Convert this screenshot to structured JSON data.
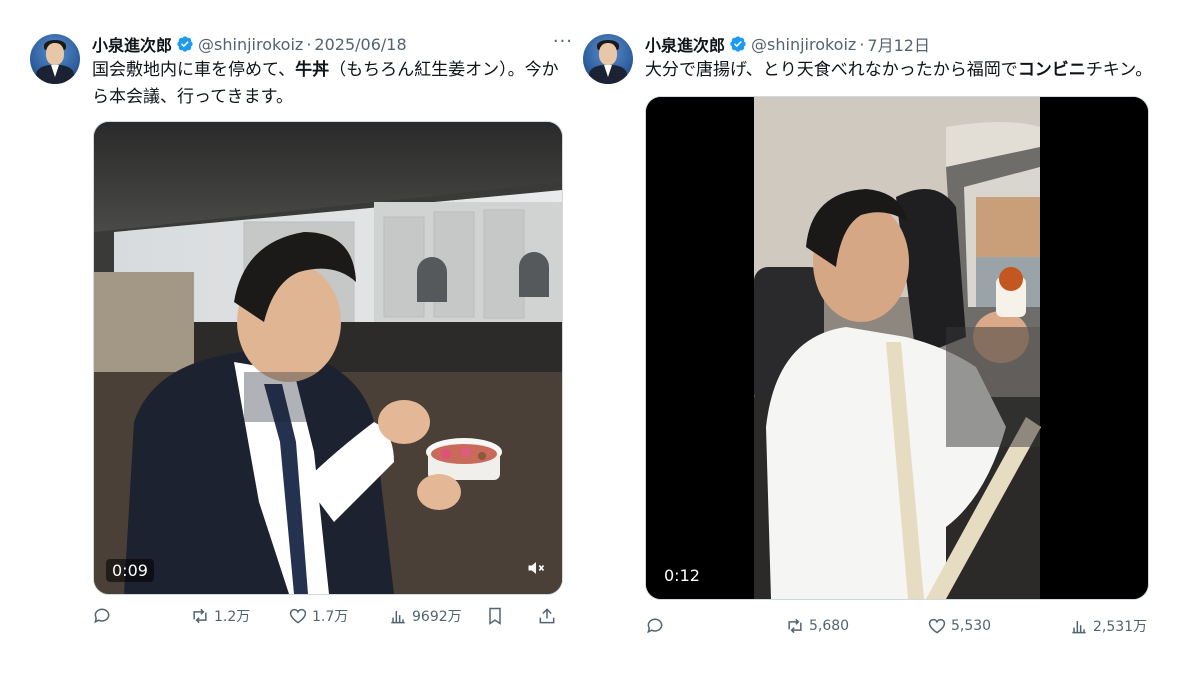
{
  "tweets": [
    {
      "name": "小泉進次郎",
      "handle": "@shinjirokoiz",
      "separator": "·",
      "date": "2025/06/18",
      "more": "···",
      "text_pre": "国会敷地内に車を停めて、",
      "text_bold": "牛丼",
      "text_post": "（もちろん紅生姜オン）。今から本会議、行ってきます。",
      "video": {
        "timecode": "0:09",
        "muted": true
      },
      "stats": {
        "retweets": "1.2万",
        "likes": "1.7万",
        "views": "9692万"
      }
    },
    {
      "name": "小泉進次郎",
      "handle": "@shinjirokoiz",
      "separator": "·",
      "date": "7月12日",
      "text_pre": "大分で唐揚げ、とり天食べれなかったから福岡で",
      "text_bold": "コンビニ",
      "text_post": "チキン。",
      "video": {
        "timecode": "0:12"
      },
      "stats": {
        "retweets": "5,680",
        "likes": "5,530",
        "views": "2,531万"
      }
    }
  ],
  "colors": {
    "verified": "#1d9bf0",
    "muted_text": "#536471",
    "text": "#0f1419"
  },
  "icons": [
    "verified-badge-icon",
    "more-icon",
    "reply-icon",
    "retweet-icon",
    "like-icon",
    "views-icon",
    "bookmark-icon",
    "share-icon",
    "mute-icon"
  ]
}
